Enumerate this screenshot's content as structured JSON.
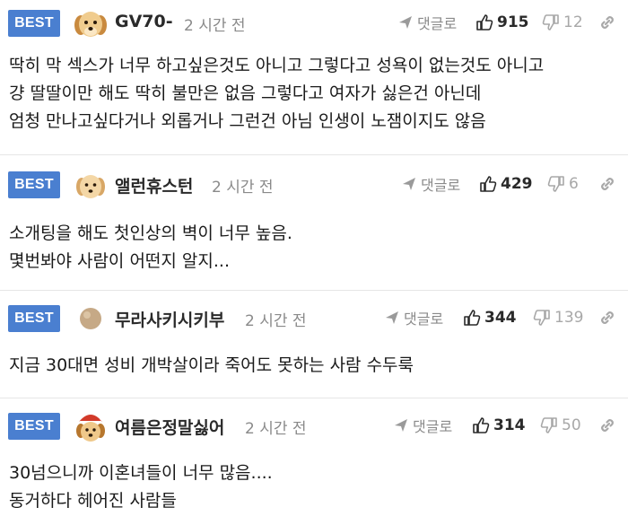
{
  "comments": [
    {
      "badge": "BEST",
      "avatar": "puppy-avatar",
      "nickname": "GV70-",
      "time": "2 시간 전",
      "reply_label": "댓글로",
      "likes": "915",
      "dislikes": "12",
      "lines": [
        "딱히 막 섹스가 너무 하고싶은것도 아니고 그렇다고 성욕이 없는것도 아니고",
        "걍 딸딸이만 해도 딱히 불만은 없음 그렇다고 여자가 싫은건 아닌데",
        "엄청 만나고싶다거나 외롭거나 그런건 아님 인생이 노잼이지도 않음"
      ]
    },
    {
      "badge": "BEST",
      "avatar": "puppy-avatar",
      "nickname": "앨런휴스턴",
      "time": "2 시간 전",
      "reply_label": "댓글로",
      "likes": "429",
      "dislikes": "6",
      "lines": [
        "소개팅을 해도 첫인상의 벽이 너무 높음.",
        "몇번봐야 사람이 어떤지 알지..."
      ]
    },
    {
      "badge": "BEST",
      "avatar": "egg-avatar",
      "nickname": "무라사키시키부",
      "time": "2 시간 전",
      "reply_label": "댓글로",
      "likes": "344",
      "dislikes": "139",
      "lines": [
        "지금 30대면 성비 개박살이라 죽어도 못하는 사람 수두룩"
      ]
    },
    {
      "badge": "BEST",
      "avatar": "puppy-santa-avatar",
      "nickname": "여름은정말싫어",
      "time": "2 시간 전",
      "reply_label": "댓글로",
      "likes": "314",
      "dislikes": "50",
      "lines": [
        "30넘으니까 이혼녀들이 너무 많음....",
        "동거하다 헤어진 사람들"
      ]
    }
  ],
  "colors": {
    "badge": "#4a7fd0",
    "muted": "#8a8a8a",
    "divider": "#e6e6e6"
  }
}
